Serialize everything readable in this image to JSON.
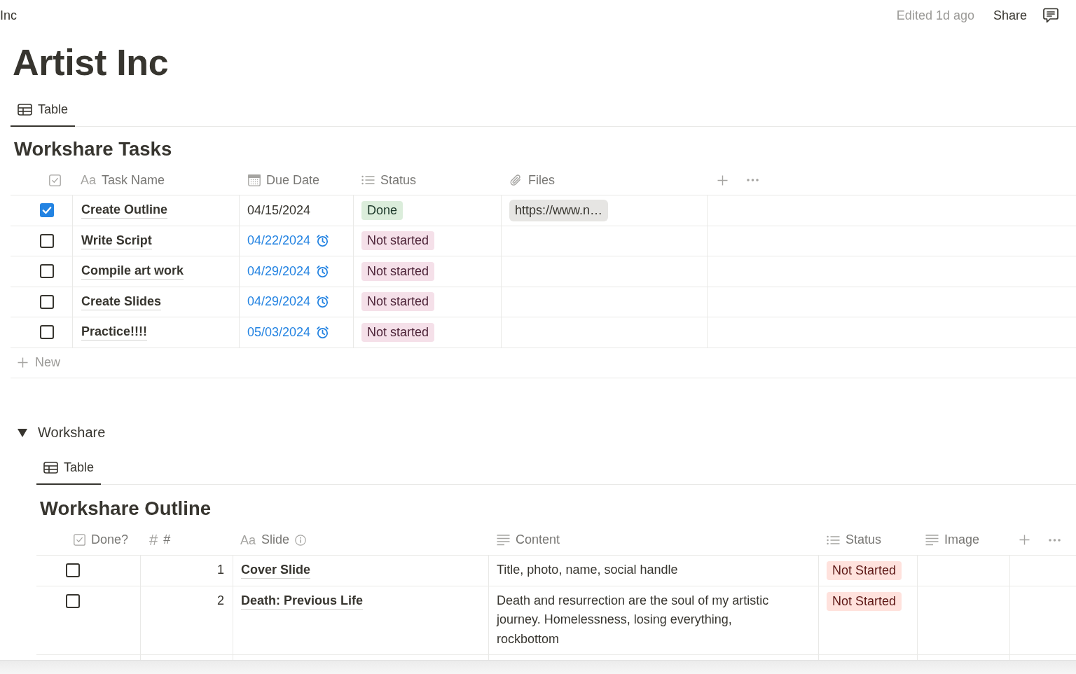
{
  "breadcrumb": "Inc",
  "topbar": {
    "edited": "Edited 1d ago",
    "share": "Share"
  },
  "title": "Artist Inc",
  "views": [
    {
      "label": "Table",
      "selected": true
    }
  ],
  "tasks": {
    "title": "Workshare Tasks",
    "columns": [
      {
        "kind": "checkbox"
      },
      {
        "kind": "title",
        "glyph": "Aa",
        "label": "Task Name"
      },
      {
        "kind": "date",
        "label": "Due Date"
      },
      {
        "kind": "select",
        "label": "Status"
      },
      {
        "kind": "files",
        "label": "Files"
      }
    ],
    "rows": [
      {
        "done": true,
        "name": "Create Outline",
        "due": "04/15/2024",
        "reminder": false,
        "status": {
          "label": "Done",
          "color": "#dbeddb"
        },
        "files": [
          "https://www.n…"
        ]
      },
      {
        "done": false,
        "name": "Write Script",
        "due": "04/22/2024",
        "reminder": true,
        "status": {
          "label": "Not started",
          "color": "#f5e0e9"
        }
      },
      {
        "done": false,
        "name": "Compile art work",
        "due": "04/29/2024",
        "reminder": true,
        "status": {
          "label": "Not started",
          "color": "#f5e0e9"
        }
      },
      {
        "done": false,
        "name": "Create Slides",
        "due": "04/29/2024",
        "reminder": true,
        "status": {
          "label": "Not started",
          "color": "#f5e0e9"
        }
      },
      {
        "done": false,
        "name": "Practice!!!!",
        "due": "05/03/2024",
        "reminder": true,
        "status": {
          "label": "Not started",
          "color": "#f5e0e9"
        }
      }
    ],
    "new_row": "New"
  },
  "toggle": {
    "label": "Workshare",
    "expanded": true,
    "views": [
      {
        "label": "Table",
        "selected": true
      }
    ],
    "outline": {
      "title": "Workshare Outline",
      "columns": [
        {
          "kind": "checkbox",
          "label": "Done?"
        },
        {
          "kind": "number",
          "glyph": "#",
          "label": "#"
        },
        {
          "kind": "title",
          "glyph": "Aa",
          "label": "Slide",
          "info": true
        },
        {
          "kind": "text",
          "label": "Content"
        },
        {
          "kind": "select",
          "label": "Status"
        },
        {
          "kind": "text",
          "label": "Image"
        }
      ],
      "rows": [
        {
          "done": false,
          "number": "1",
          "slide": "Cover Slide",
          "content": "Title, photo, name, social handle",
          "status": {
            "label": "Not Started",
            "color": "#ffe2dd"
          }
        },
        {
          "done": false,
          "number": "2",
          "slide": "Death: Previous Life",
          "content": "Death and resurrection are the soul of my artistic journey. Homelessness, losing everything, rockbottom",
          "status": {
            "label": "Not Started",
            "color": "#ffe2dd"
          }
        }
      ]
    }
  }
}
